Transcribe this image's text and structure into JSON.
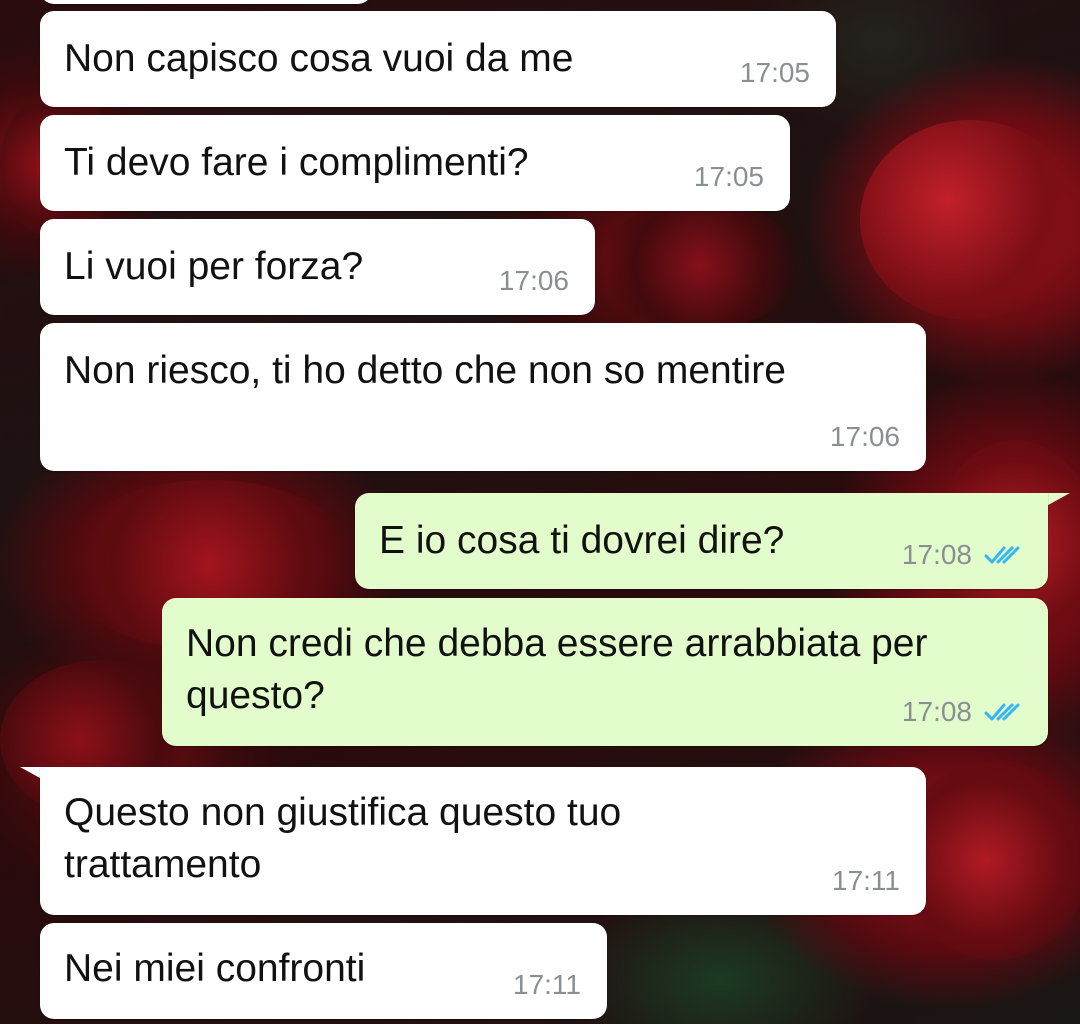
{
  "chat": {
    "messages": [
      {
        "direction": "incoming",
        "lines": [
          "Non capisco cosa vuoi da me"
        ],
        "time": "17:05"
      },
      {
        "direction": "incoming",
        "lines": [
          "Ti devo fare i complimenti?"
        ],
        "time": "17:05"
      },
      {
        "direction": "incoming",
        "lines": [
          "Li vuoi per forza?"
        ],
        "time": "17:06"
      },
      {
        "direction": "incoming",
        "lines": [
          "Non riesco, ti ho detto che non so mentire"
        ],
        "time": "17:06"
      },
      {
        "direction": "outgoing",
        "lines": [
          "E io cosa ti dovrei dire?"
        ],
        "time": "17:08",
        "status": "read"
      },
      {
        "direction": "outgoing",
        "lines": [
          "Non credi che debba essere arrabbiata per",
          "questo?"
        ],
        "time": "17:08",
        "status": "read"
      },
      {
        "direction": "incoming",
        "lines": [
          "Questo non giustifica questo tuo",
          "trattamento"
        ],
        "time": "17:11"
      },
      {
        "direction": "incoming",
        "lines": [
          "Nei miei confronti"
        ],
        "time": "17:11"
      }
    ]
  },
  "colors": {
    "incoming_bubble": "#ffffff",
    "outgoing_bubble": "#e2fdcb",
    "timestamp": "#8a8f93",
    "read_ticks": "#34b7f1",
    "wallpaper": "#2a0c0e"
  },
  "icons": {
    "read_receipt": "double-check-icon",
    "wallpaper": "red-roses-wallpaper"
  }
}
